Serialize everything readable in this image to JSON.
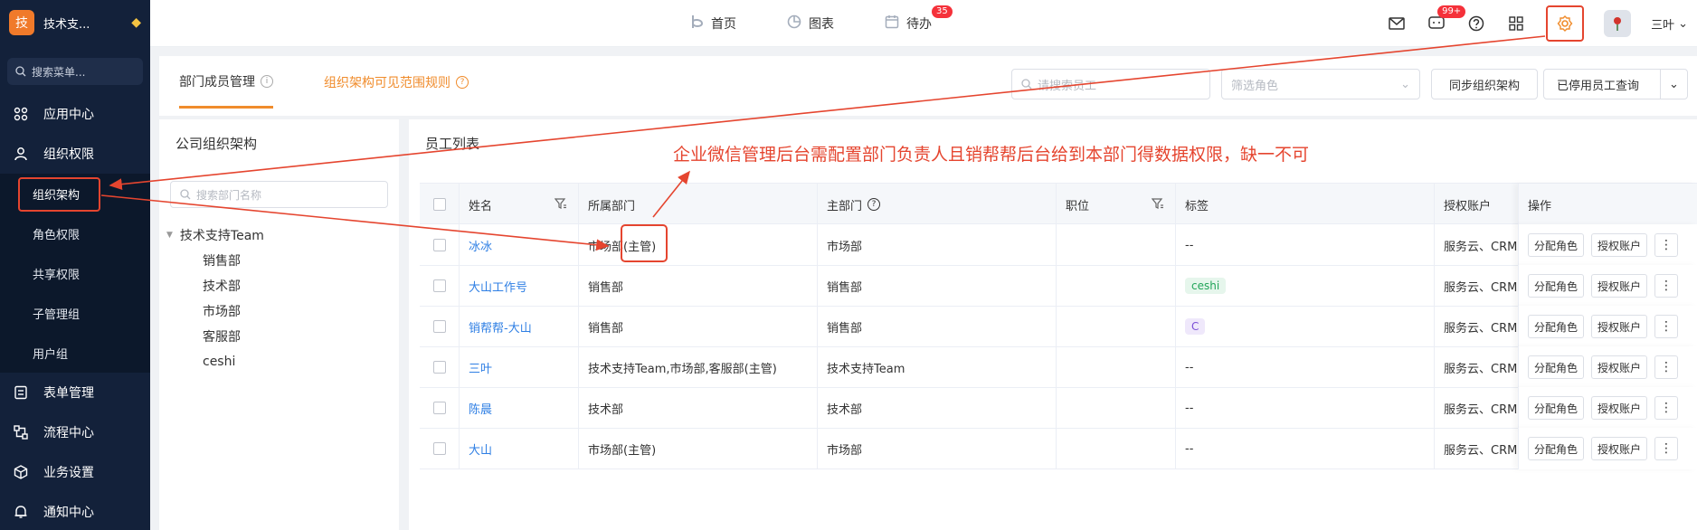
{
  "sidebar": {
    "logo_char": "技",
    "company": "技术支...",
    "search_placeholder": "搜索菜单...",
    "items": [
      {
        "label": "应用中心",
        "icon": "app-grid-icon"
      },
      {
        "label": "组织权限",
        "icon": "user-icon"
      },
      {
        "label": "表单管理",
        "icon": "form-icon"
      },
      {
        "label": "流程中心",
        "icon": "flow-icon"
      },
      {
        "label": "业务设置",
        "icon": "cube-icon"
      },
      {
        "label": "通知中心",
        "icon": "bell-icon"
      }
    ],
    "sub_items": [
      "组织架构",
      "角色权限",
      "共享权限",
      "子管理组",
      "用户组"
    ]
  },
  "topbar": {
    "nav": [
      {
        "label": "首页",
        "icon": "home-icon"
      },
      {
        "label": "图表",
        "icon": "chart-icon"
      },
      {
        "label": "待办",
        "icon": "calendar-icon",
        "badge": "35"
      }
    ],
    "message_badge": "99+",
    "user_name": "三叶"
  },
  "header": {
    "tab_active": "部门成员管理",
    "tab_link": "组织架构可见范围规则",
    "search_placeholder": "请搜索员工",
    "role_placeholder": "筛选角色",
    "sync_button": "同步组织架构",
    "disabled_query": "已停用员工查询"
  },
  "org": {
    "title": "公司组织架构",
    "search_placeholder": "搜索部门名称",
    "root": "技术支持Team",
    "children": [
      "销售部",
      "技术部",
      "市场部",
      "客服部",
      "ceshi"
    ]
  },
  "employees": {
    "title": "员工列表",
    "columns": {
      "name": "姓名",
      "dept": "所属部门",
      "main_dept": "主部门",
      "position": "职位",
      "tags": "标签",
      "account": "授权账户",
      "ops": "操作"
    },
    "rows": [
      {
        "name": "冰冰",
        "dept": "市场部(主管)",
        "main_dept": "市场部",
        "position": "",
        "tag": "--",
        "account": "服务云、CRM"
      },
      {
        "name": "大山工作号",
        "dept": "销售部",
        "main_dept": "销售部",
        "position": "",
        "tag": "ceshi",
        "account": "服务云、CRM"
      },
      {
        "name": "销帮帮-大山",
        "dept": "销售部",
        "main_dept": "销售部",
        "position": "",
        "tag": "C",
        "account": "服务云、CRM"
      },
      {
        "name": "三叶",
        "dept": "技术支持Team,市场部,客服部(主管)",
        "main_dept": "技术支持Team",
        "position": "",
        "tag": "--",
        "account": "服务云、CRM"
      },
      {
        "name": "陈晨",
        "dept": "技术部",
        "main_dept": "技术部",
        "position": "",
        "tag": "--",
        "account": "服务云、CRM"
      },
      {
        "name": "大山",
        "dept": "市场部(主管)",
        "main_dept": "市场部",
        "position": "",
        "tag": "--",
        "account": "服务云、CRM"
      }
    ],
    "op_assign_role": "分配角色",
    "op_auth_account": "授权账户",
    "op_more": "⋮"
  },
  "annotation": "企业微信管理后台需配置部门负责人且销帮帮后台给到本部门得数据权限，缺一不可",
  "colors": {
    "accent": "#f08c2c",
    "sidebar": "#13213a",
    "annotation": "#e5452f",
    "link": "#2f7fe4"
  }
}
